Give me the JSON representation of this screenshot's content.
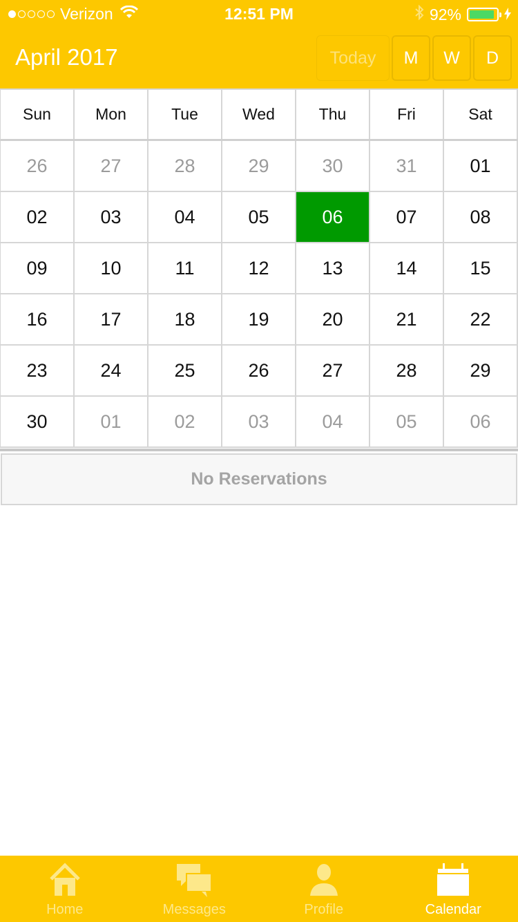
{
  "status_bar": {
    "carrier": "Verizon",
    "time": "12:51 PM",
    "battery_percent": "92%",
    "battery_level": 0.92,
    "signal_bars": 1,
    "signal_total": 5
  },
  "header": {
    "title": "April 2017",
    "today_label": "Today",
    "month_view_label": "M",
    "week_view_label": "W",
    "day_view_label": "D"
  },
  "calendar": {
    "weekdays": [
      "Sun",
      "Mon",
      "Tue",
      "Wed",
      "Thu",
      "Fri",
      "Sat"
    ],
    "weeks": [
      [
        {
          "d": "26",
          "m": true
        },
        {
          "d": "27",
          "m": true
        },
        {
          "d": "28",
          "m": true
        },
        {
          "d": "29",
          "m": true
        },
        {
          "d": "30",
          "m": true
        },
        {
          "d": "31",
          "m": true
        },
        {
          "d": "01",
          "m": false
        }
      ],
      [
        {
          "d": "02",
          "m": false
        },
        {
          "d": "03",
          "m": false
        },
        {
          "d": "04",
          "m": false
        },
        {
          "d": "05",
          "m": false
        },
        {
          "d": "06",
          "m": false,
          "selected": true
        },
        {
          "d": "07",
          "m": false
        },
        {
          "d": "08",
          "m": false
        }
      ],
      [
        {
          "d": "09",
          "m": false
        },
        {
          "d": "10",
          "m": false
        },
        {
          "d": "11",
          "m": false
        },
        {
          "d": "12",
          "m": false
        },
        {
          "d": "13",
          "m": false
        },
        {
          "d": "14",
          "m": false
        },
        {
          "d": "15",
          "m": false
        }
      ],
      [
        {
          "d": "16",
          "m": false
        },
        {
          "d": "17",
          "m": false
        },
        {
          "d": "18",
          "m": false
        },
        {
          "d": "19",
          "m": false
        },
        {
          "d": "20",
          "m": false
        },
        {
          "d": "21",
          "m": false
        },
        {
          "d": "22",
          "m": false
        }
      ],
      [
        {
          "d": "23",
          "m": false
        },
        {
          "d": "24",
          "m": false
        },
        {
          "d": "25",
          "m": false
        },
        {
          "d": "26",
          "m": false
        },
        {
          "d": "27",
          "m": false
        },
        {
          "d": "28",
          "m": false
        },
        {
          "d": "29",
          "m": false
        }
      ],
      [
        {
          "d": "30",
          "m": false
        },
        {
          "d": "01",
          "m": true
        },
        {
          "d": "02",
          "m": true
        },
        {
          "d": "03",
          "m": true
        },
        {
          "d": "04",
          "m": true
        },
        {
          "d": "05",
          "m": true
        },
        {
          "d": "06",
          "m": true
        }
      ]
    ]
  },
  "reservations": {
    "empty_text": "No Reservations"
  },
  "tabbar": {
    "tabs": [
      {
        "label": "Home",
        "icon": "home-icon",
        "active": false
      },
      {
        "label": "Messages",
        "icon": "messages-icon",
        "active": false
      },
      {
        "label": "Profile",
        "icon": "profile-icon",
        "active": false
      },
      {
        "label": "Calendar",
        "icon": "calendar-icon",
        "active": true
      }
    ]
  },
  "colors": {
    "accent": "#fdc800",
    "selected_day": "#009a00",
    "muted_text": "#9b9b9b",
    "battery_fill": "#4cd964"
  }
}
